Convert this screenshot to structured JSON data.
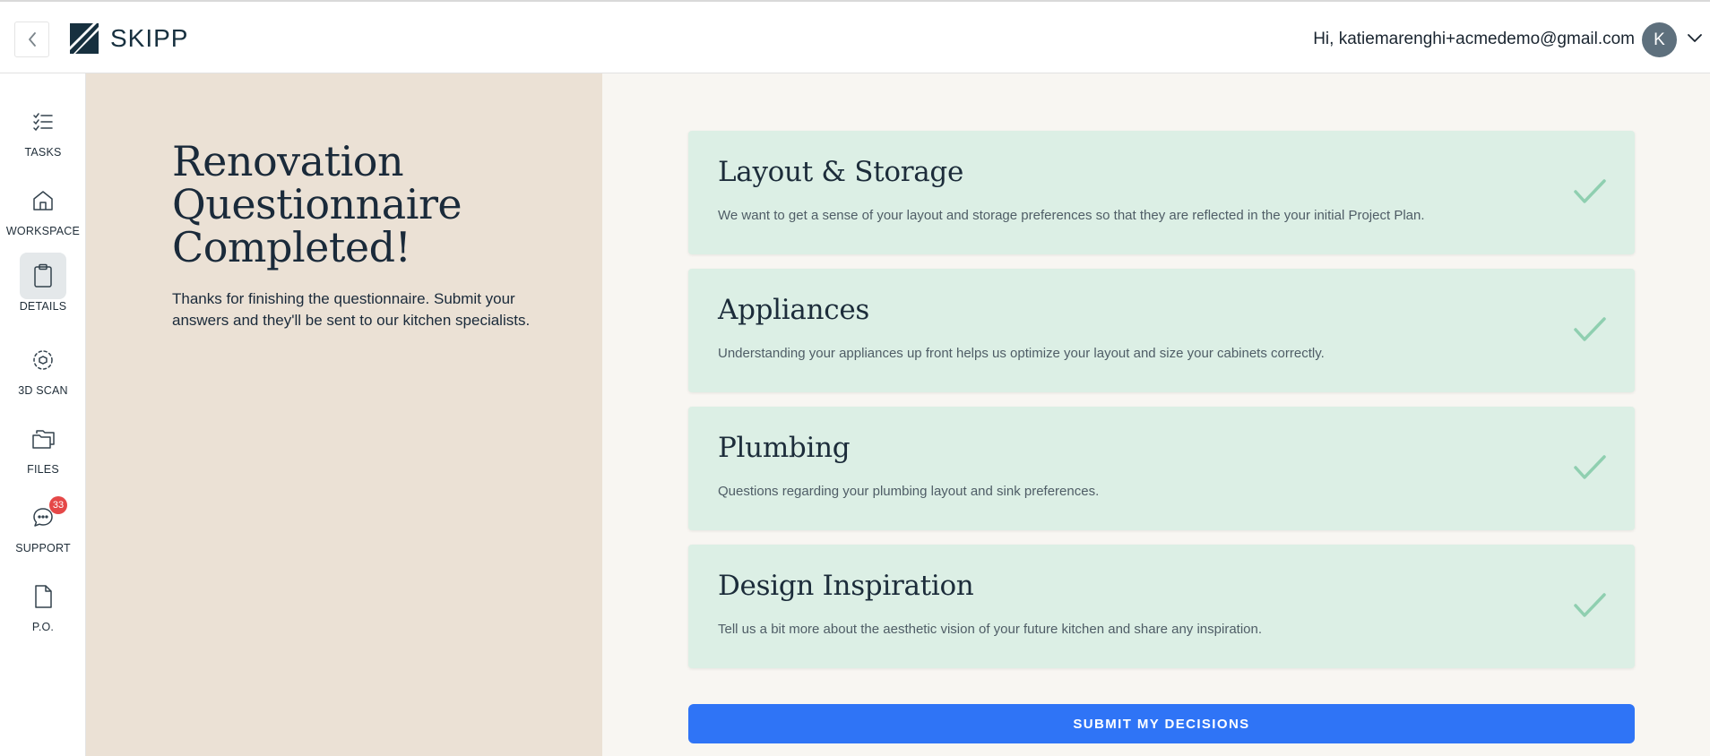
{
  "header": {
    "brand": "SKIPP",
    "greeting": "Hi, katiemarenghi+acmedemo@gmail.com",
    "avatar_initial": "K",
    "icons": {
      "back": "chevron-left-icon",
      "account_menu": "chevron-down-icon",
      "logo": "skipp-logo-icon"
    }
  },
  "sidebar": {
    "items": [
      {
        "label": "TASKS",
        "icon": "checklist-icon",
        "active": false
      },
      {
        "label": "WORKSPACE",
        "icon": "home-icon",
        "active": false
      },
      {
        "label": "DETAILS",
        "icon": "clipboard-icon",
        "active": true
      },
      {
        "label": "3D SCAN",
        "icon": "scan-cube-icon",
        "active": false
      },
      {
        "label": "FILES",
        "icon": "folders-icon",
        "active": false
      },
      {
        "label": "SUPPORT",
        "icon": "chat-bubble-icon",
        "active": false,
        "badge": "33"
      },
      {
        "label": "P.O.",
        "icon": "document-icon",
        "active": false
      }
    ]
  },
  "intro": {
    "title": "Renovation Questionnaire Completed!",
    "body": "Thanks for finishing the questionnaire. Submit your answers and they'll be sent to our kitchen specialists."
  },
  "sections": [
    {
      "title": "Layout & Storage",
      "description": "We want to get a sense of your layout and storage preferences so that they are reflected in the your initial Project Plan.",
      "completed": true
    },
    {
      "title": "Appliances",
      "description": "Understanding your appliances up front helps us optimize your layout and size your cabinets correctly.",
      "completed": true
    },
    {
      "title": "Plumbing",
      "description": "Questions regarding your plumbing layout and sink preferences.",
      "completed": true
    },
    {
      "title": "Design Inspiration",
      "description": "Tell us a bit more about the aesthetic vision of your future kitchen and share any inspiration.",
      "completed": true
    }
  ],
  "submit_label": "SUBMIT MY DECISIONS",
  "colors": {
    "accent": "#2f74f6",
    "left_panel": "#ebe1d5",
    "card_bg": "#dcefe5",
    "check": "#8fcfb0",
    "badge": "#e54848",
    "navy": "#17303f"
  }
}
